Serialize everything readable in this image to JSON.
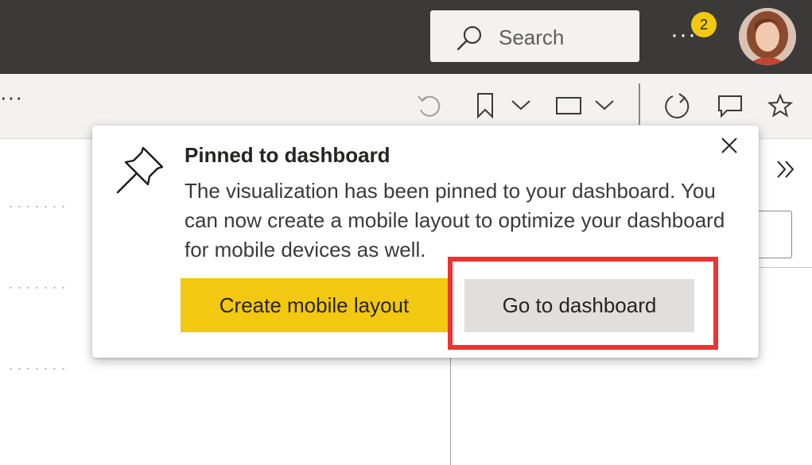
{
  "header": {
    "search_placeholder": "Search",
    "more_label": "···",
    "notification_count": "2",
    "avatar_alt": "User avatar"
  },
  "toolbar": {
    "ellipsis": "···",
    "icons": [
      "undo-icon",
      "bookmark-icon",
      "chevron-down-icon",
      "view-icon",
      "chevron-down-icon",
      "refresh-icon",
      "comment-icon",
      "favorite-star-icon"
    ]
  },
  "popup": {
    "title": "Pinned to dashboard",
    "body": "The visualization has been pinned to your dashboard. You can now create a mobile layout to optimize your dashboard for mobile devices as well.",
    "primary_button": "Create mobile layout",
    "secondary_button": "Go to dashboard"
  },
  "colors": {
    "header_bg": "#3b3a39",
    "accent_yellow": "#f2c811",
    "highlight_red": "#f03232",
    "toolbar_bg": "#f3f2f1"
  }
}
